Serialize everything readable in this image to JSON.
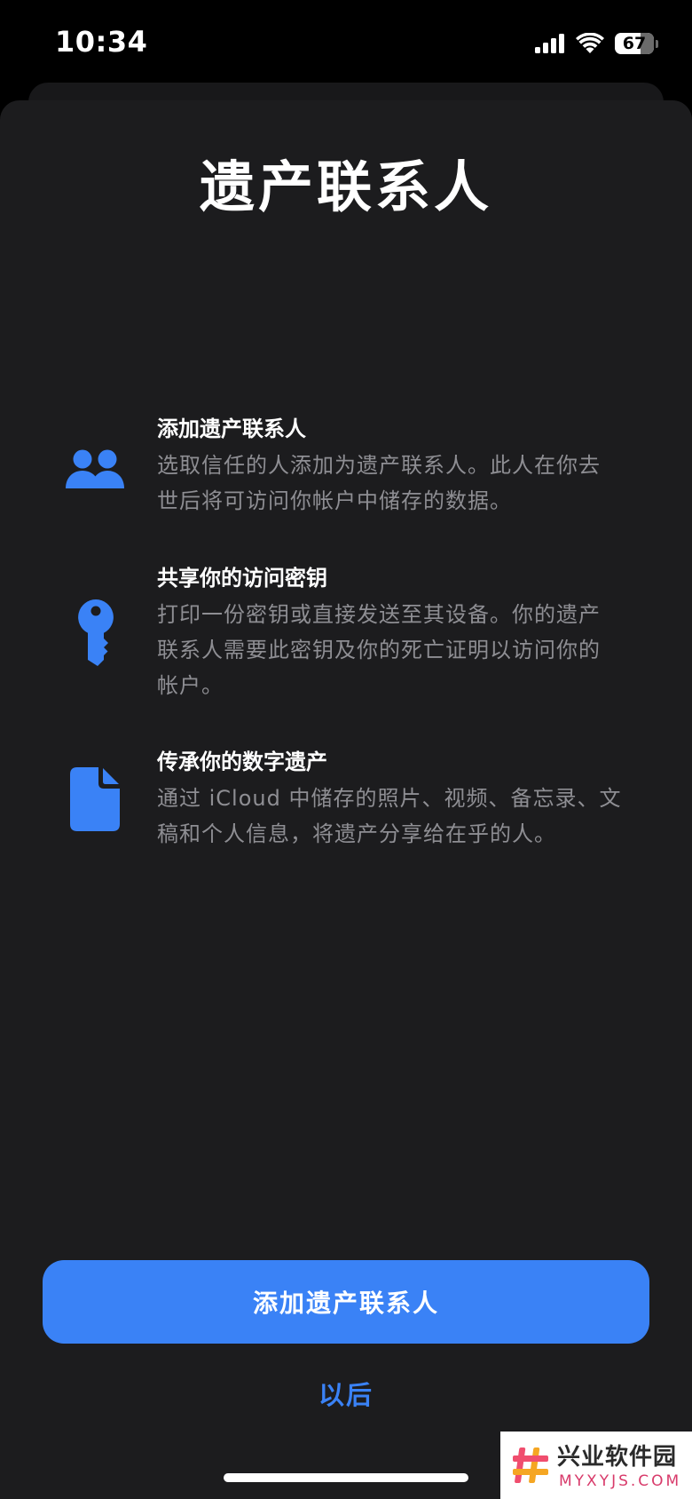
{
  "status_bar": {
    "time": "10:34",
    "battery_level": "67",
    "battery_fraction": 0.67,
    "icons": [
      "cellular-signal-icon",
      "wifi-icon",
      "battery-icon"
    ]
  },
  "page": {
    "title": "遗产联系人"
  },
  "features": [
    {
      "icon": "people-icon",
      "title": "添加遗产联系人",
      "desc_lines": [
        "选取信任的人添加为遗产联系人。此人在你去",
        "世后将可访问你帐户中储存的数据。"
      ]
    },
    {
      "icon": "key-icon",
      "title": "共享你的访问密钥",
      "desc_lines": [
        "打印一份密钥或直接发送至其设备。你的遗产",
        "联系人需要此密钥及你的死亡证明以访问你的",
        "帐户。"
      ]
    },
    {
      "icon": "document-icon",
      "title": "传承你的数字遗产",
      "desc_lines": [
        "通过 iCloud 中储存的照片、视频、备忘录、文",
        "稿和个人信息，将遗产分享给在乎的人。"
      ]
    }
  ],
  "actions": {
    "primary_label": "添加遗产联系人",
    "secondary_label": "以后"
  },
  "watermark": {
    "name": "兴业软件园",
    "url": "MYXYJS.COM"
  },
  "colors": {
    "background": "#000000",
    "sheet": "#1c1c1e",
    "accent": "#3a82f6",
    "secondary_text": "#8e8e93"
  }
}
